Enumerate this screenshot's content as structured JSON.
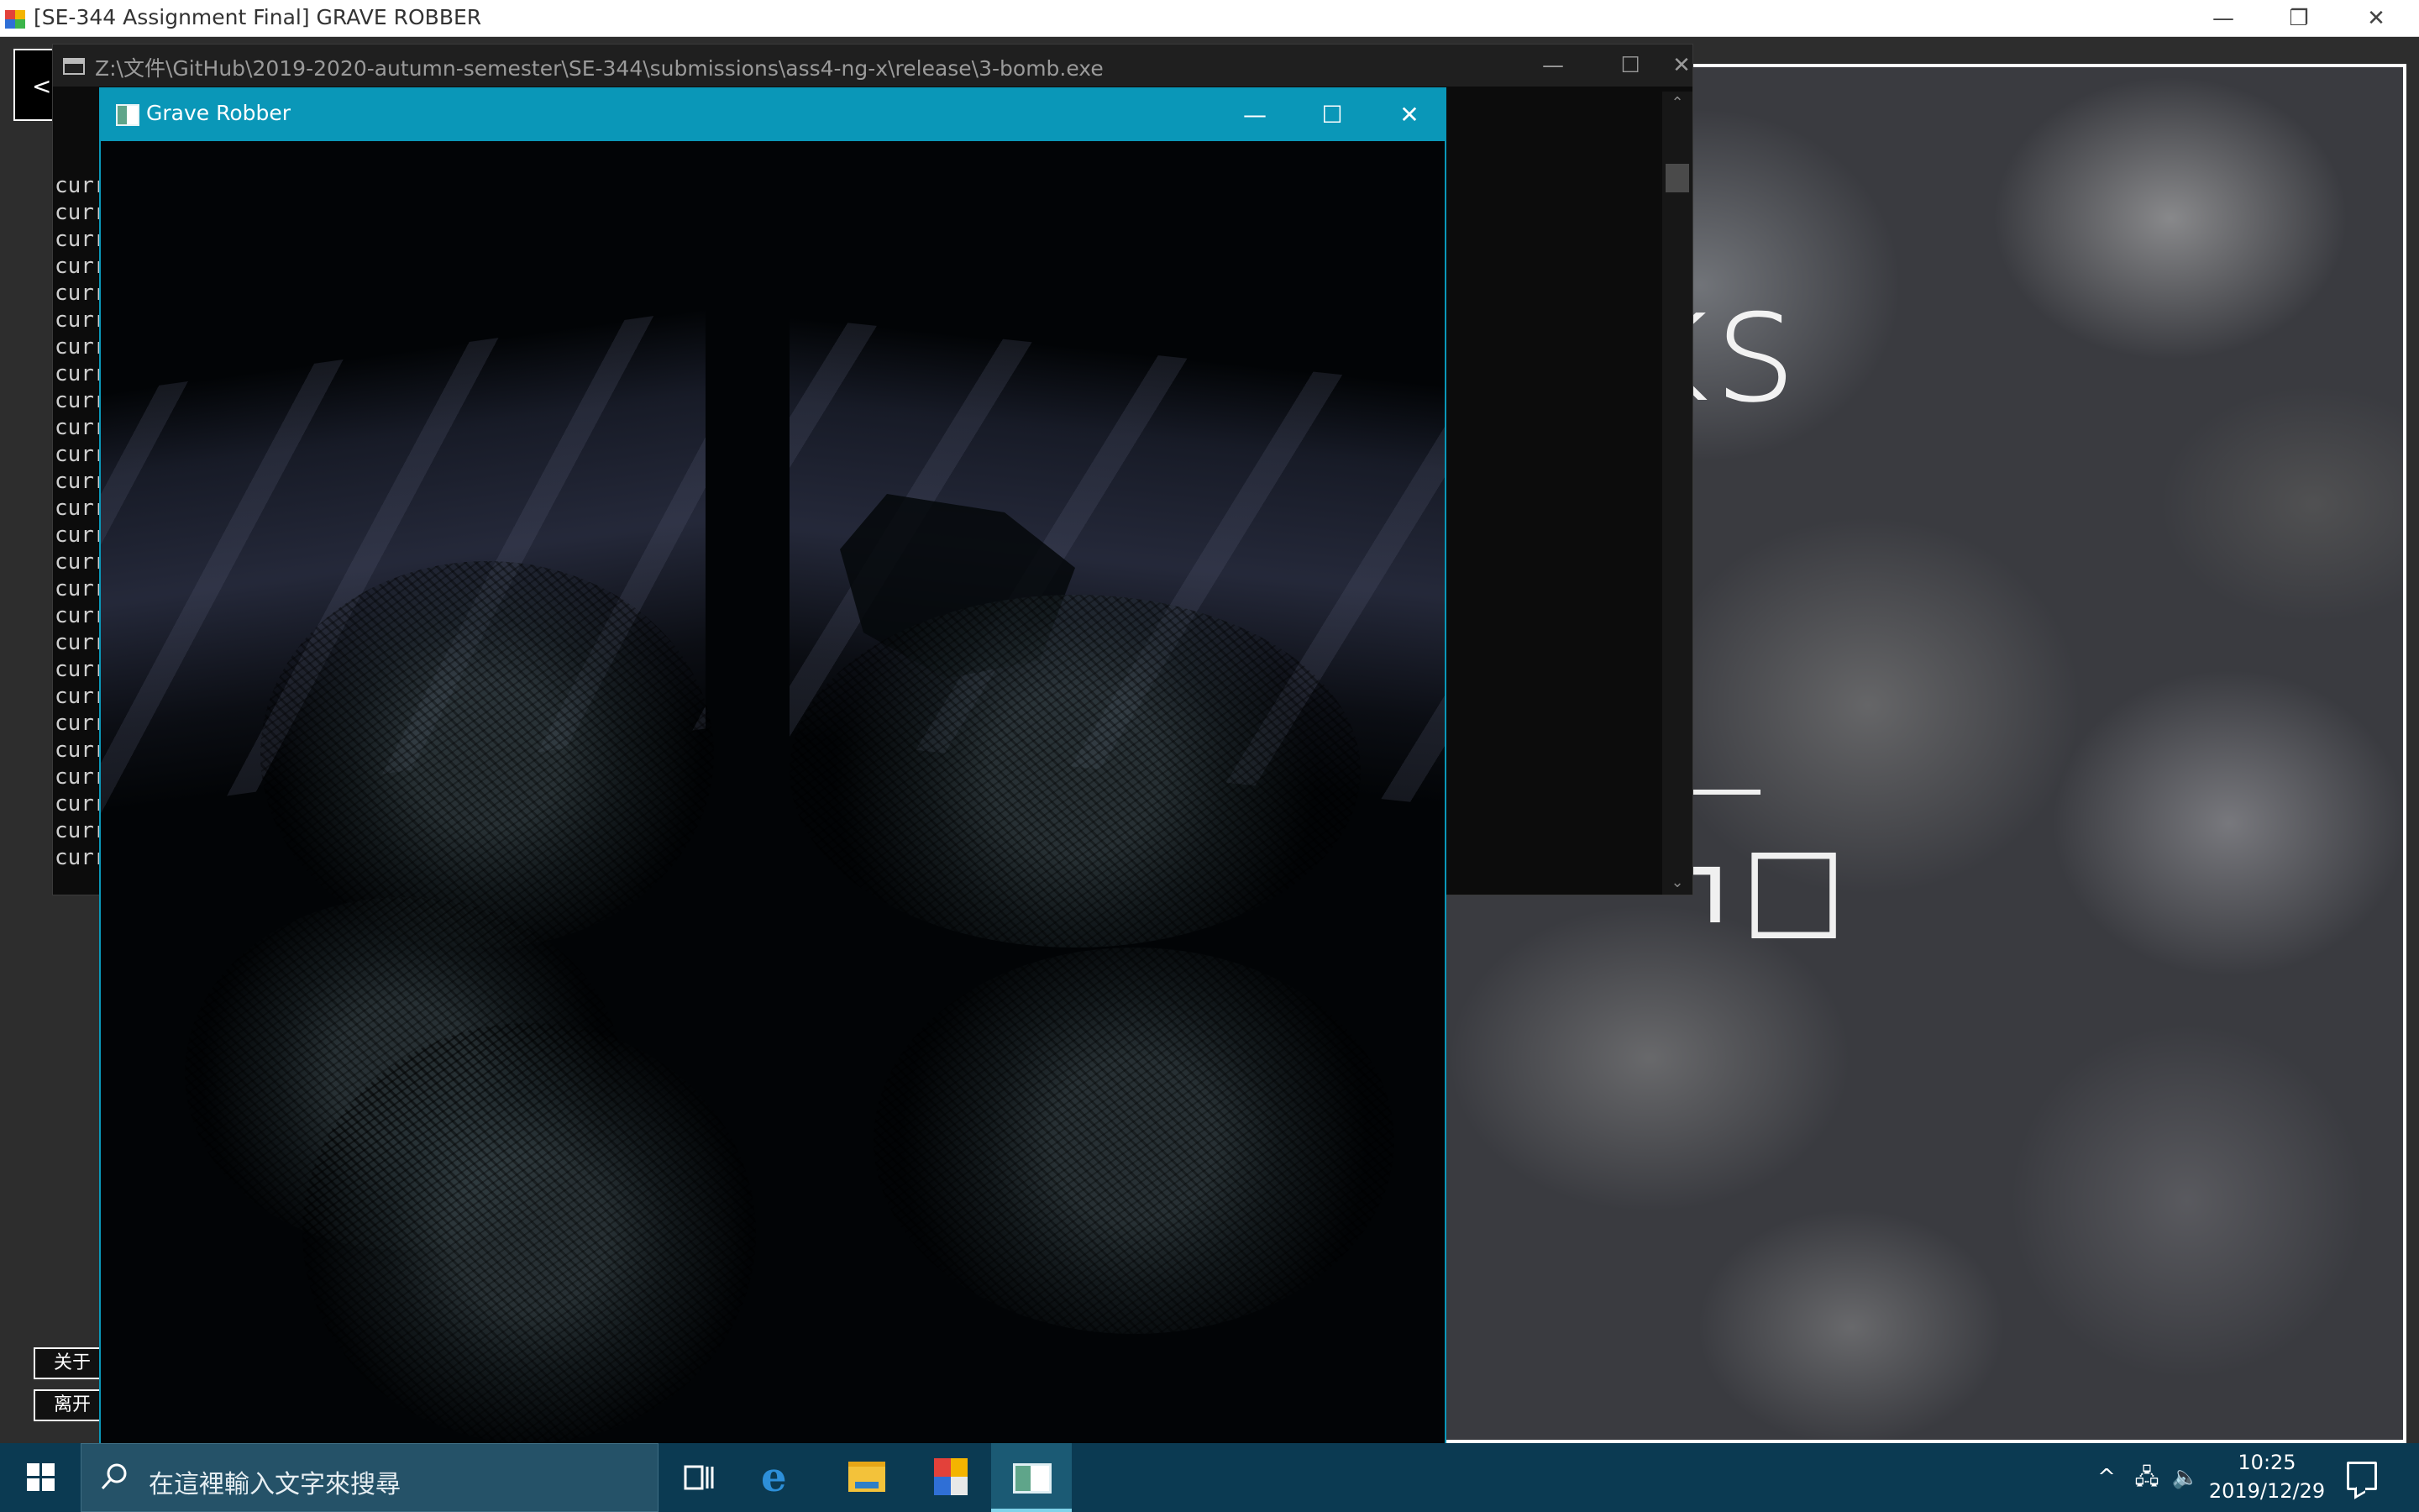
{
  "background_app": {
    "title": "[SE-344 Assignment Final] GRAVE ROBBER",
    "back_label": "<",
    "menu": [
      {
        "label": "关于"
      },
      {
        "label": "离开"
      }
    ],
    "heading_fragment": "ocks",
    "controls": {
      "minimize": "—",
      "restore": "❐",
      "close": "✕"
    }
  },
  "console": {
    "title": "Z:\\文件\\GitHub\\2019-2020-autumn-semester\\SE-344\\submissions\\ass4-ng-x\\release\\3-bomb.exe",
    "lines": [
      "curr",
      "curr",
      "curr",
      "curr",
      "curr",
      "curr",
      "curr",
      "curr",
      "curr",
      "curr",
      "curr",
      "curr",
      "curr",
      "curr",
      "curr",
      "curr",
      "curr",
      "curr",
      "curr",
      "curr",
      "curr",
      "curr",
      "curr",
      "curr",
      "curr",
      "curr"
    ],
    "controls": {
      "minimize": "—",
      "maximize": "☐",
      "close": "✕"
    }
  },
  "game_window": {
    "title": "Grave Robber",
    "controls": {
      "minimize": "—",
      "maximize": "☐",
      "close": "✕"
    }
  },
  "taskbar": {
    "search_placeholder": "在這裡輸入文字來搜尋",
    "clock_time": "10:25",
    "clock_date": "2019/12/29",
    "icons": [
      "start-icon",
      "search-icon",
      "task-view-icon",
      "edge-icon",
      "file-explorer-icon",
      "app-icon",
      "grave-robber-icon"
    ],
    "tray": {
      "chevron": "^",
      "network": "🖧",
      "volume": "🔈"
    },
    "accent": "#0b3a52"
  },
  "colors": {
    "game_titlebar": "#0a97b8",
    "console_bg": "#0c0c0c"
  }
}
